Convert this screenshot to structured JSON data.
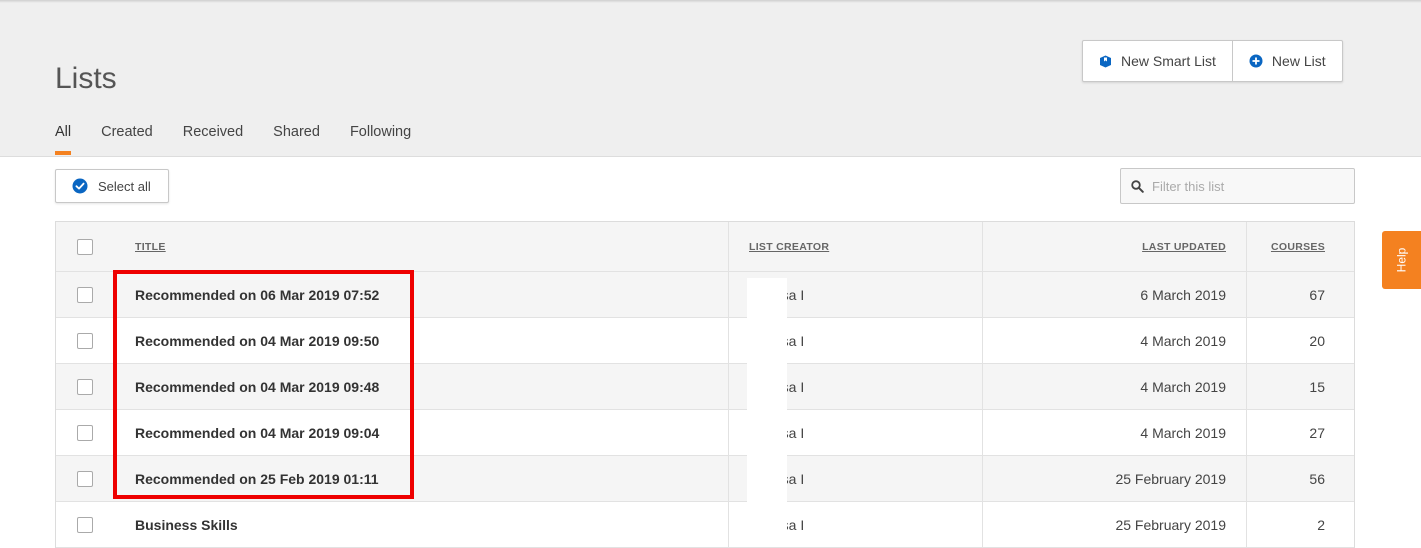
{
  "header": {
    "title": "Lists",
    "new_smart_list_label": "New Smart List",
    "new_list_label": "New List"
  },
  "tabs": [
    {
      "label": "All",
      "active": true
    },
    {
      "label": "Created",
      "active": false
    },
    {
      "label": "Received",
      "active": false
    },
    {
      "label": "Shared",
      "active": false
    },
    {
      "label": "Following",
      "active": false
    }
  ],
  "toolbar": {
    "select_all_label": "Select all",
    "filter_placeholder": "Filter this list"
  },
  "table": {
    "columns": {
      "title": "Title",
      "creator": "List creator",
      "updated": "Last updated",
      "courses": "Courses"
    },
    "rows": [
      {
        "title": "Recommended on 06 Mar 2019 07:52",
        "creator": "Melissa I",
        "updated": "6 March 2019",
        "courses": "67"
      },
      {
        "title": "Recommended on 04 Mar 2019 09:50",
        "creator": "Melissa I",
        "updated": "4 March 2019",
        "courses": "20"
      },
      {
        "title": "Recommended on 04 Mar 2019 09:48",
        "creator": "Melissa I",
        "updated": "4 March 2019",
        "courses": "15"
      },
      {
        "title": "Recommended on 04 Mar 2019 09:04",
        "creator": "Melissa I",
        "updated": "4 March 2019",
        "courses": "27"
      },
      {
        "title": "Recommended on 25 Feb 2019 01:11",
        "creator": "Melissa I",
        "updated": "25 February 2019",
        "courses": "56"
      },
      {
        "title": "Business Skills",
        "creator": "Melissa I",
        "updated": "25 February 2019",
        "courses": "2"
      }
    ]
  },
  "help_label": "Help",
  "colors": {
    "accent": "#f48120",
    "brand_blue": "#0a66c2",
    "highlight": "#ee0000"
  },
  "icons": {
    "smart_list": "bookmark-box-icon",
    "new_list": "plus-circle-icon",
    "select_all": "check-circle-icon",
    "filter": "search-icon"
  }
}
